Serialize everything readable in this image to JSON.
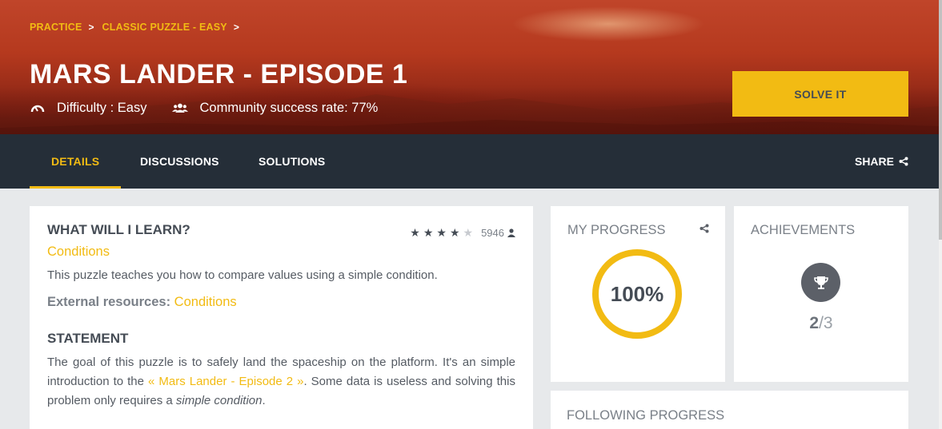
{
  "hero": {
    "breadcrumb": [
      "PRACTICE",
      "CLASSIC PUZZLE - EASY"
    ],
    "title": "MARS LANDER - EPISODE 1",
    "difficulty": "Difficulty : Easy",
    "success_rate": "Community success rate: 77%",
    "solve_label": "SOLVE IT",
    "accent": "#f2bb13"
  },
  "nav": {
    "tabs": [
      {
        "label": "DETAILS",
        "active": true
      },
      {
        "label": "DISCUSSIONS",
        "active": false
      },
      {
        "label": "SOLUTIONS",
        "active": false
      }
    ],
    "share_label": "SHARE"
  },
  "learn": {
    "title": "WHAT WILL I LEARN?",
    "rating_stars": 4,
    "rating_max": 5,
    "rating_count": "5946",
    "topic": "Conditions",
    "description": "This puzzle teaches you how to compare values using a simple condition.",
    "external_label": "External resources:",
    "external_link": "Conditions"
  },
  "statement": {
    "title": "STATEMENT",
    "text_before": "The goal of this puzzle is to safely land the spaceship on the platform. It's an simple introduction to the ",
    "link": "« Mars Lander - Episode 2 »",
    "text_middle": ". Some data is useless and solving this problem only requires a ",
    "emphasis": "simple condition",
    "text_after": "."
  },
  "progress": {
    "title": "MY PROGRESS",
    "value": "100%"
  },
  "achievements": {
    "title": "ACHIEVEMENTS",
    "earned": "2",
    "total": "/3"
  },
  "following": {
    "title": "FOLLOWING PROGRESS"
  }
}
